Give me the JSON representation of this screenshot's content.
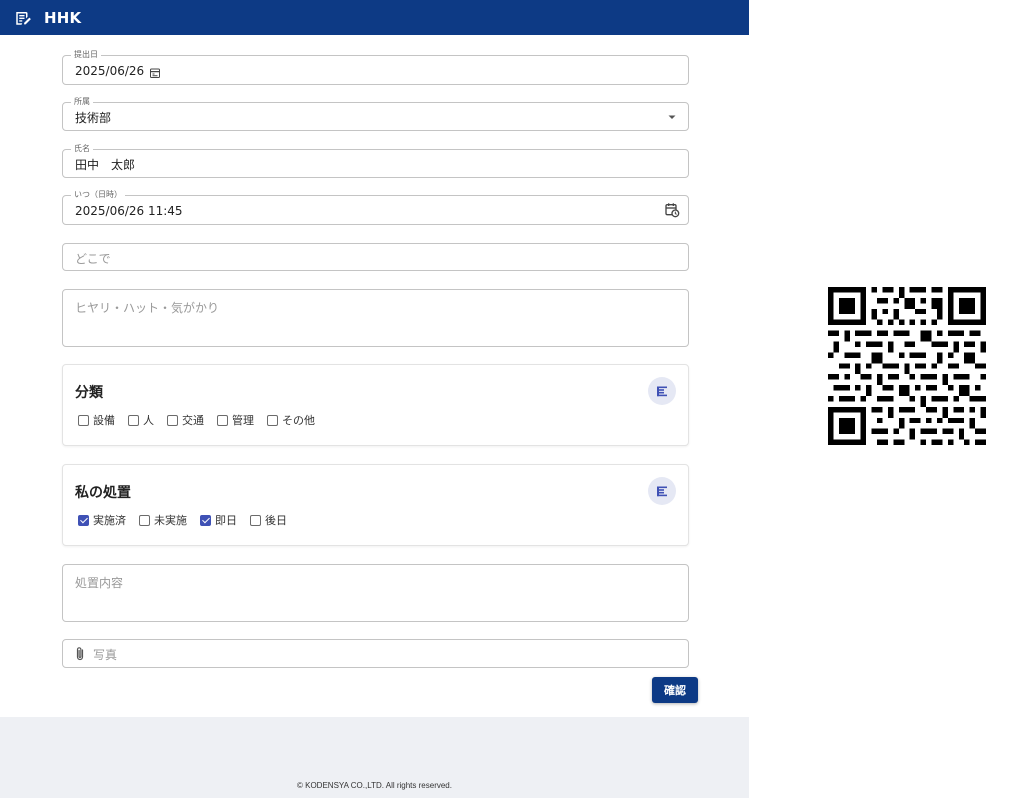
{
  "app": {
    "title": "HHK"
  },
  "form": {
    "submit_date": {
      "label": "提出日",
      "value": "2025/06/26"
    },
    "department": {
      "label": "所属",
      "value": "技術部"
    },
    "name": {
      "label": "氏名",
      "value": "田中　太郎"
    },
    "when": {
      "label": "いつ（日時）",
      "value": "2025/06/26 11:45"
    },
    "where": {
      "placeholder": "どこで"
    },
    "incident": {
      "placeholder": "ヒヤリ・ハット・気がかり"
    },
    "category": {
      "title": "分類",
      "options": [
        {
          "label": "設備",
          "checked": false
        },
        {
          "label": "人",
          "checked": false
        },
        {
          "label": "交通",
          "checked": false
        },
        {
          "label": "管理",
          "checked": false
        },
        {
          "label": "その他",
          "checked": false
        }
      ]
    },
    "action": {
      "title": "私の処置",
      "options": [
        {
          "label": "実施済",
          "checked": true
        },
        {
          "label": "未実施",
          "checked": false
        },
        {
          "label": "即日",
          "checked": true
        },
        {
          "label": "後日",
          "checked": false
        }
      ]
    },
    "action_details": {
      "placeholder": "処置内容"
    },
    "photo": {
      "placeholder": "写真"
    },
    "confirm_label": "確認"
  },
  "footer": {
    "copyright": "© KODENSYA CO.,LTD. All rights reserved."
  },
  "colors": {
    "appbar": "#0d3a85",
    "checkbox_checked": "#3f51b5",
    "footer_bg": "#eef0f4"
  },
  "icons": {
    "logo": "edit-note-icon",
    "calendar": "calendar-icon",
    "dropdown": "dropdown-arrow-icon",
    "datetime": "calendar-clock-icon",
    "list": "list-icon",
    "attach": "paperclip-icon"
  }
}
